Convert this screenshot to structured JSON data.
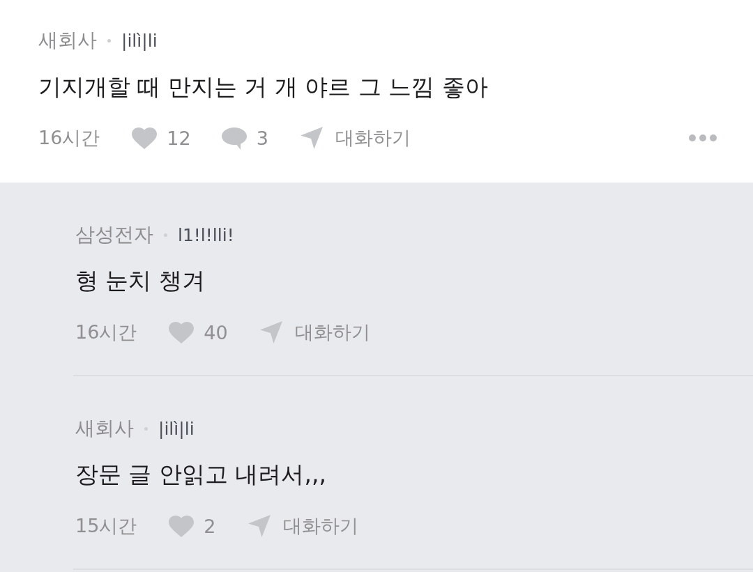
{
  "post_comment": {
    "author": "새회사",
    "handle": "|ilì|li",
    "text": "기지개할 때 만지는 거 개 야르 그 느낌 좋아",
    "time": "16시간",
    "likes": "12",
    "replies": "3",
    "action": "대화하기"
  },
  "replies": [
    {
      "author": "삼성전자",
      "handle": "l1!l!lli!",
      "text": "형 눈치 챙겨",
      "time": "16시간",
      "likes": "40",
      "action": "대화하기"
    },
    {
      "author": "새회사",
      "handle": "|ilì|li",
      "text": "장문 글 안읽고 내려서,,,",
      "time": "15시간",
      "likes": "2",
      "action": "대화하기"
    }
  ]
}
